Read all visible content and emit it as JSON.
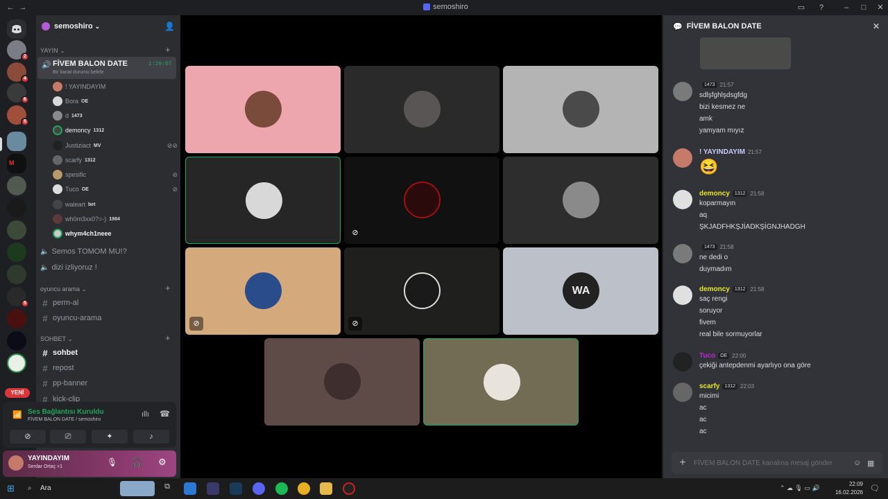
{
  "titlebar": {
    "title": "semoshiro",
    "back": "←",
    "forward": "→"
  },
  "server": {
    "name": "semoshiro",
    "new_badge": "YENİ"
  },
  "rail_badges": [
    "2",
    "4",
    "6",
    "5",
    "5"
  ],
  "categories": {
    "yayin": "YAYIN",
    "oyuncu": "oyuncu arama",
    "sohbet": "SOHBET"
  },
  "voice_channel": {
    "name": "FİVEM BALON DATE",
    "status": "Bir kanal durumu belirle",
    "timer": "1:29:07",
    "users": [
      {
        "name": "! YAYINDAYIM",
        "tag": ""
      },
      {
        "name": "Bora",
        "tag": "OE"
      },
      {
        "name": "d",
        "tag": "1473"
      },
      {
        "name": "demoncy",
        "tag": "1312"
      },
      {
        "name": "Justiziact",
        "tag": "MV"
      },
      {
        "name": "scarfy",
        "tag": "1312"
      },
      {
        "name": "spesific",
        "tag": ""
      },
      {
        "name": "Tuco",
        "tag": "OE"
      },
      {
        "name": "waleart",
        "tag": "bet"
      },
      {
        "name": "wh0m3xx0?=-)",
        "tag": "1984"
      },
      {
        "name": "whym4ch1neee",
        "tag": ""
      }
    ]
  },
  "other_voice": [
    "Semos TOMOM MU!?",
    "dizi izliyoruz !"
  ],
  "oyuncu_channels": [
    "perm-al",
    "oyuncu-arama"
  ],
  "sohbet_channels": [
    "sohbet",
    "repost",
    "pp-banner",
    "kick-clip"
  ],
  "voice_panel": {
    "status": "Ses Bağlantısı Kuruldu",
    "location": "FİVEM BALON DATE / semoshiro"
  },
  "user_panel": {
    "name": "YAYINDAYIM",
    "activity": "Serdar Ortaç +1"
  },
  "chat": {
    "title": "FİVEM BALON DATE",
    "input_placeholder": "FİVEM BALON DATE kanalına mesaj gönder",
    "messages": [
      {
        "author": "",
        "badge": "1473",
        "time": "21:57",
        "color": "#a855f7",
        "lines": [
          "sdlşfghlşdsgfdg",
          "bizi kesmez ne",
          "amk",
          "yamyam mıyız"
        ]
      },
      {
        "author": "! YAYINDAYIM",
        "badge": "",
        "time": "21:57",
        "color": "#c9cdfb",
        "lines": [
          "😆"
        ]
      },
      {
        "author": "demoncy",
        "badge": "1312",
        "time": "21:58",
        "color": "#e5e52a",
        "lines": [
          "koparmayın",
          "aq",
          "ŞKJADFHKŞJİADKŞİGNJHADGH"
        ]
      },
      {
        "author": "",
        "badge": "1473",
        "time": "21:58",
        "color": "#a855f7",
        "lines": [
          "ne dedi o",
          "duymadım"
        ]
      },
      {
        "author": "demoncy",
        "badge": "1312",
        "time": "21:58",
        "color": "#e5e52a",
        "lines": [
          "saç rengi",
          "soruyor",
          "fivem",
          "real bile sormuyorlar"
        ]
      },
      {
        "author": "Tuco",
        "badge": "OE",
        "time": "22:00",
        "color": "#c026d3",
        "lines": [
          "çekiği antepdenmi ayarlıyo ona göre"
        ]
      },
      {
        "author": "scarfy",
        "badge": "1312",
        "time": "22:03",
        "color": "#e5e52a",
        "lines": [
          "micimi",
          "ac",
          "ac",
          "ac"
        ]
      }
    ]
  },
  "taskbar": {
    "search": "Ara",
    "time": "22:09",
    "date": "16.02.2026"
  }
}
